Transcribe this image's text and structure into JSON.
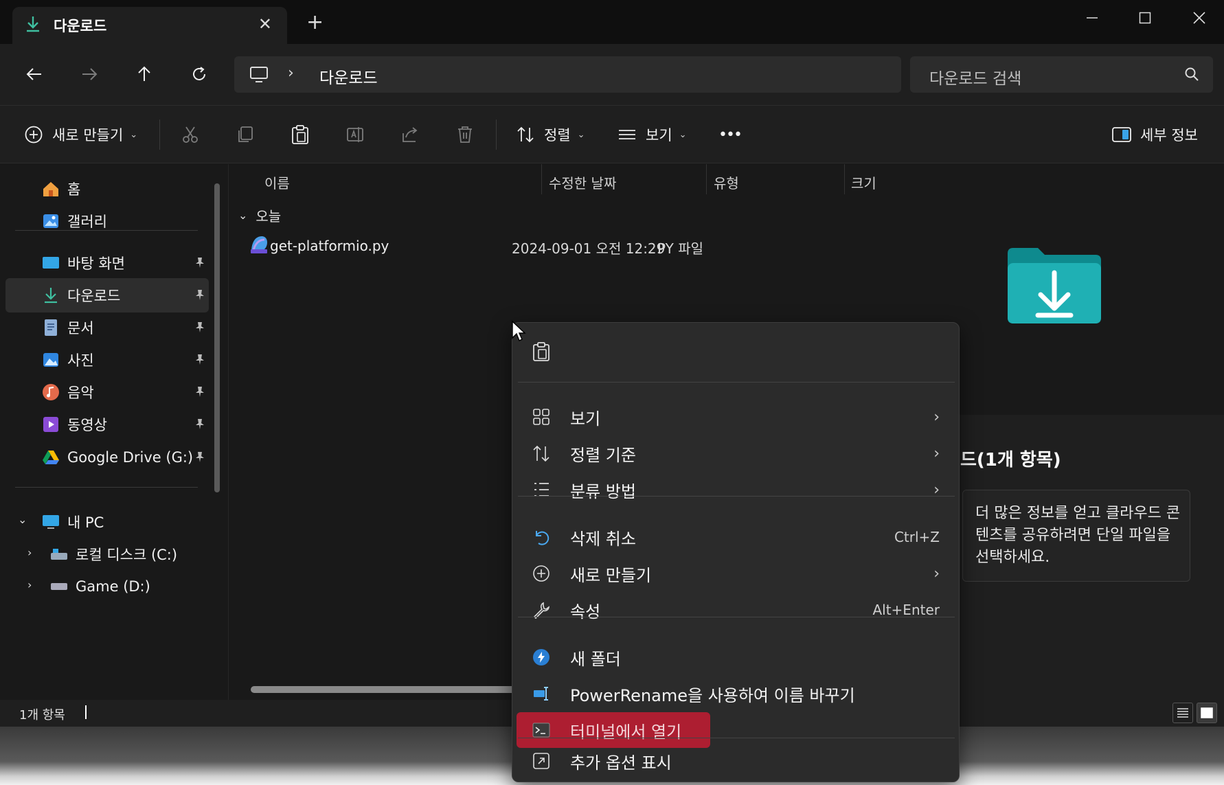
{
  "window": {
    "tab_title": "다운로드",
    "tab_close": "✕",
    "new_tab": "+"
  },
  "address": {
    "crumb": "다운로드",
    "separator": "›",
    "search_placeholder": "다운로드 검색"
  },
  "commandbar": {
    "new_label": "새로 만들기",
    "sort_label": "정렬",
    "view_label": "보기",
    "more_label": "•••",
    "details_label": "세부 정보"
  },
  "sidebar": {
    "home": "홈",
    "gallery": "갤러리",
    "desktop": "바탕 화면",
    "downloads": "다운로드",
    "documents": "문서",
    "pictures": "사진",
    "music": "음악",
    "videos": "동영상",
    "gdrive": "Google Drive (G:)",
    "this_pc": "내 PC",
    "drive_c": "로컬 디스크 (C:)",
    "drive_d": "Game (D:)"
  },
  "filelist": {
    "columns": [
      "이름",
      "수정한 날짜",
      "유형",
      "크기"
    ],
    "group_label": "오늘",
    "files": [
      {
        "name": "get-platformio.py",
        "modified": "2024-09-01 오전 12:29",
        "type": "PY 파일"
      }
    ]
  },
  "details": {
    "title": "드(1개 항목)",
    "body": "더 많은 정보를 얻고 클라우드 콘텐츠를 공유하려면 단일 파일을 선택하세요."
  },
  "status": {
    "count": "1개 항목"
  },
  "context_menu": {
    "view": "보기",
    "sort_by": "정렬 기준",
    "group_by": "분류 방법",
    "undo_delete": "삭제 취소",
    "undo_shortcut": "Ctrl+Z",
    "new": "새로 만들기",
    "properties": "속성",
    "properties_shortcut": "Alt+Enter",
    "new_folder": "새 폴더",
    "powerrename": "PowerRename을 사용하여 이름 바꾸기",
    "open_terminal": "터미널에서 열기",
    "more_options": "추가 옵션 표시",
    "arrow": "›"
  },
  "colors": {
    "accent_teal": "#1aa3a8",
    "highlight_red": "#ad1e31",
    "background": "#191919"
  }
}
